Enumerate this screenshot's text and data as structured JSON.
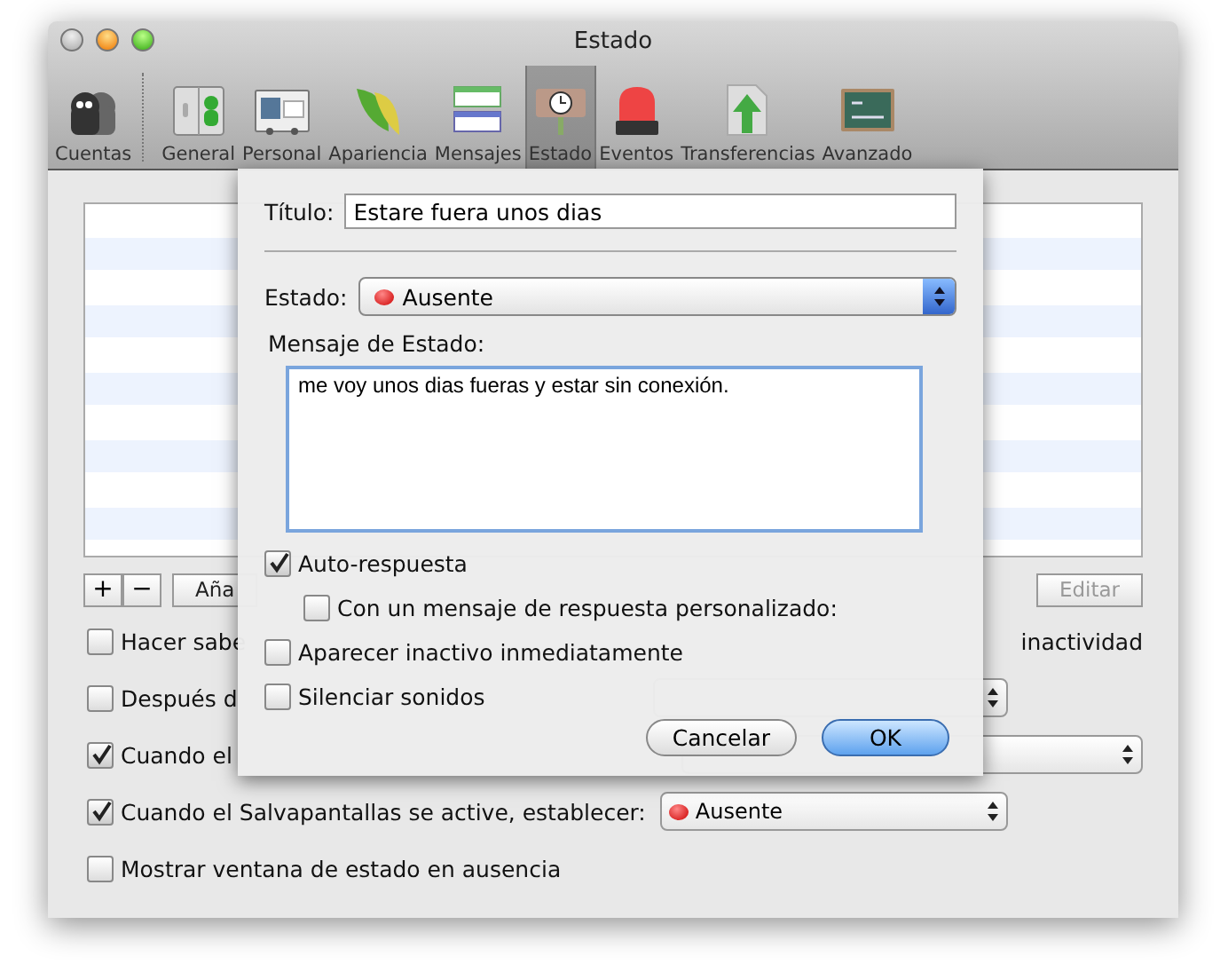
{
  "window": {
    "title": "Estado"
  },
  "toolbar": {
    "items": [
      {
        "label": "Cuentas",
        "selected": false
      },
      {
        "label": "General",
        "selected": false
      },
      {
        "label": "Personal",
        "selected": false
      },
      {
        "label": "Apariencia",
        "selected": false
      },
      {
        "label": "Mensajes",
        "selected": false
      },
      {
        "label": "Estado",
        "selected": true
      },
      {
        "label": "Eventos",
        "selected": false
      },
      {
        "label": "Transferencias",
        "selected": false
      },
      {
        "label": "Avanzado",
        "selected": false
      }
    ]
  },
  "list_buttons": {
    "add": "+",
    "remove": "−",
    "add_status": "Aña",
    "edit": {
      "label": "Editar",
      "disabled": true
    }
  },
  "options": [
    {
      "kind": "check",
      "text": "Hacer sabe",
      "trailing": "inactividad",
      "checked": false
    },
    {
      "kind": "popup",
      "text": "Después d",
      "checked": false
    },
    {
      "kind": "popup",
      "text": "Cuando el",
      "checked": true
    },
    {
      "kind": "popup",
      "text": "Cuando el Salvapantallas se active, establecer:",
      "checked": true,
      "popup": "Ausente"
    },
    {
      "kind": "check",
      "text": "Mostrar ventana de estado en ausencia",
      "checked": false
    }
  ],
  "sheet": {
    "title_label": "Título:",
    "title_value": "Estare fuera unos dias",
    "status_label": "Estado:",
    "status_value": "Ausente",
    "message_label": "Mensaje de Estado:",
    "message_value": "me voy unos dias fueras y estar sin conexión.",
    "checks": [
      {
        "label": "Auto-respuesta",
        "checked": true,
        "indented": false
      },
      {
        "label": "Con un mensaje de respuesta personalizado:",
        "checked": false,
        "indented": true
      },
      {
        "label": "Aparecer inactivo inmediatamente",
        "checked": false,
        "indented": false
      },
      {
        "label": "Silenciar sonidos",
        "checked": false,
        "indented": false
      }
    ],
    "cancel": "Cancelar",
    "ok": "OK"
  }
}
